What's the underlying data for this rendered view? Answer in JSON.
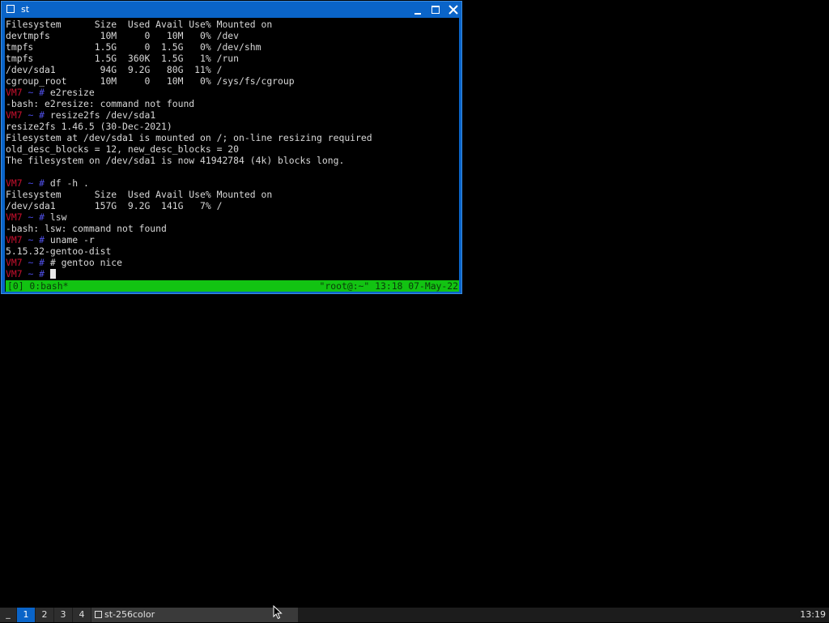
{
  "window": {
    "title": "st"
  },
  "terminal": {
    "lines": [
      {
        "type": "text",
        "text": "Filesystem      Size  Used Avail Use% Mounted on"
      },
      {
        "type": "text",
        "text": "devtmpfs         10M     0   10M   0% /dev"
      },
      {
        "type": "text",
        "text": "tmpfs           1.5G     0  1.5G   0% /dev/shm"
      },
      {
        "type": "text",
        "text": "tmpfs           1.5G  360K  1.5G   1% /run"
      },
      {
        "type": "text",
        "text": "/dev/sda1        94G  9.2G   80G  11% /"
      },
      {
        "type": "text",
        "text": "cgroup_root      10M     0   10M   0% /sys/fs/cgroup"
      },
      {
        "type": "prompt",
        "host": "VM7",
        "path": "~",
        "symbol": "#",
        "cmd": "e2resize"
      },
      {
        "type": "text",
        "text": "-bash: e2resize: command not found"
      },
      {
        "type": "prompt",
        "host": "VM7",
        "path": "~",
        "symbol": "#",
        "cmd": "resize2fs /dev/sda1"
      },
      {
        "type": "text",
        "text": "resize2fs 1.46.5 (30-Dec-2021)"
      },
      {
        "type": "text",
        "text": "Filesystem at /dev/sda1 is mounted on /; on-line resizing required"
      },
      {
        "type": "text",
        "text": "old_desc_blocks = 12, new_desc_blocks = 20"
      },
      {
        "type": "text",
        "text": "The filesystem on /dev/sda1 is now 41942784 (4k) blocks long."
      },
      {
        "type": "text",
        "text": ""
      },
      {
        "type": "prompt",
        "host": "VM7",
        "path": "~",
        "symbol": "#",
        "cmd": "df -h ."
      },
      {
        "type": "text",
        "text": "Filesystem      Size  Used Avail Use% Mounted on"
      },
      {
        "type": "text",
        "text": "/dev/sda1       157G  9.2G  141G   7% /"
      },
      {
        "type": "prompt",
        "host": "VM7",
        "path": "~",
        "symbol": "#",
        "cmd": "lsw"
      },
      {
        "type": "text",
        "text": "-bash: lsw: command not found"
      },
      {
        "type": "prompt",
        "host": "VM7",
        "path": "~",
        "symbol": "#",
        "cmd": "uname -r"
      },
      {
        "type": "text",
        "text": "5.15.32-gentoo-dist"
      },
      {
        "type": "prompt",
        "host": "VM7",
        "path": "~",
        "symbol": "#",
        "cmd": "# gentoo nice"
      },
      {
        "type": "prompt",
        "host": "VM7",
        "path": "~",
        "symbol": "#",
        "cmd": "",
        "cursor": true
      }
    ]
  },
  "statusbar": {
    "left": "[0] 0:bash*",
    "right": "\"root@:~\" 13:18 07-May-22"
  },
  "taskbar": {
    "menu_label": "_",
    "workspaces": [
      {
        "label": "1",
        "active": true
      },
      {
        "label": "2",
        "active": false
      },
      {
        "label": "3",
        "active": false
      },
      {
        "label": "4",
        "active": false
      }
    ],
    "task_label": "st-256color",
    "clock": "13:19"
  },
  "colors": {
    "title_bar": "#0a64c8",
    "status_bar": "#12c312",
    "prompt_host": "#c8102e",
    "prompt_path": "#4848e0"
  }
}
